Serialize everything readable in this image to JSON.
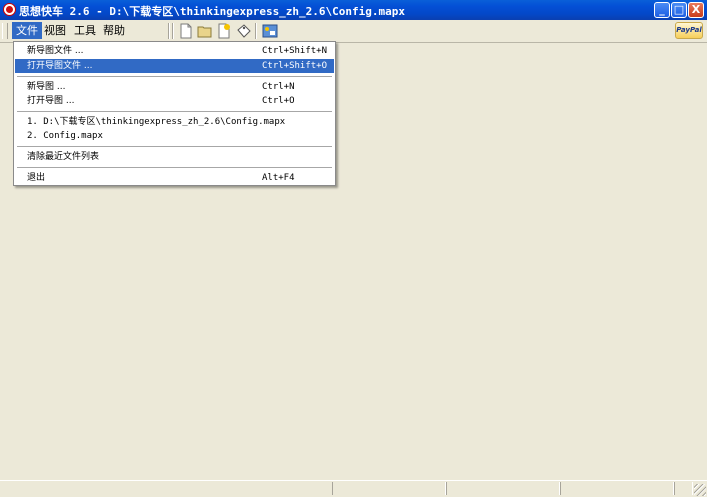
{
  "window": {
    "title": "思想快车 2.6 - D:\\下载专区\\thinkingexpress_zh_2.6\\Config.mapx",
    "minimize": "_",
    "maximize": "□",
    "close": "X"
  },
  "menubar": {
    "items": [
      {
        "label": "文件",
        "active": true
      },
      {
        "label": "视图"
      },
      {
        "label": "工具"
      },
      {
        "label": "帮助"
      }
    ]
  },
  "toolbar": {
    "tools": [
      "new-file-icon",
      "open-folder-icon",
      "new-note-icon",
      "tag-icon",
      "map-icon"
    ],
    "paypal_label": "PayPal"
  },
  "file_menu": {
    "items": [
      {
        "label": "新导图文件 ...",
        "shortcut": "Ctrl+Shift+N"
      },
      {
        "label": "打开导图文件 ...",
        "shortcut": "Ctrl+Shift+O",
        "highlighted": true
      },
      {
        "label": "新导图 ...",
        "shortcut": "Ctrl+N"
      },
      {
        "label": "打开导图 ...",
        "shortcut": "Ctrl+O"
      },
      {
        "label": "1. D:\\下载专区\\thinkingexpress_zh_2.6\\Config.mapx",
        "shortcut": ""
      },
      {
        "label": "2. Config.mapx",
        "shortcut": ""
      },
      {
        "label": "清除最近文件列表",
        "shortcut": ""
      },
      {
        "label": "退出",
        "shortcut": "Alt+F4"
      }
    ]
  },
  "colors": {
    "titlebar": "#0450d6",
    "highlight": "#316ac5",
    "face": "#ece9d8"
  }
}
